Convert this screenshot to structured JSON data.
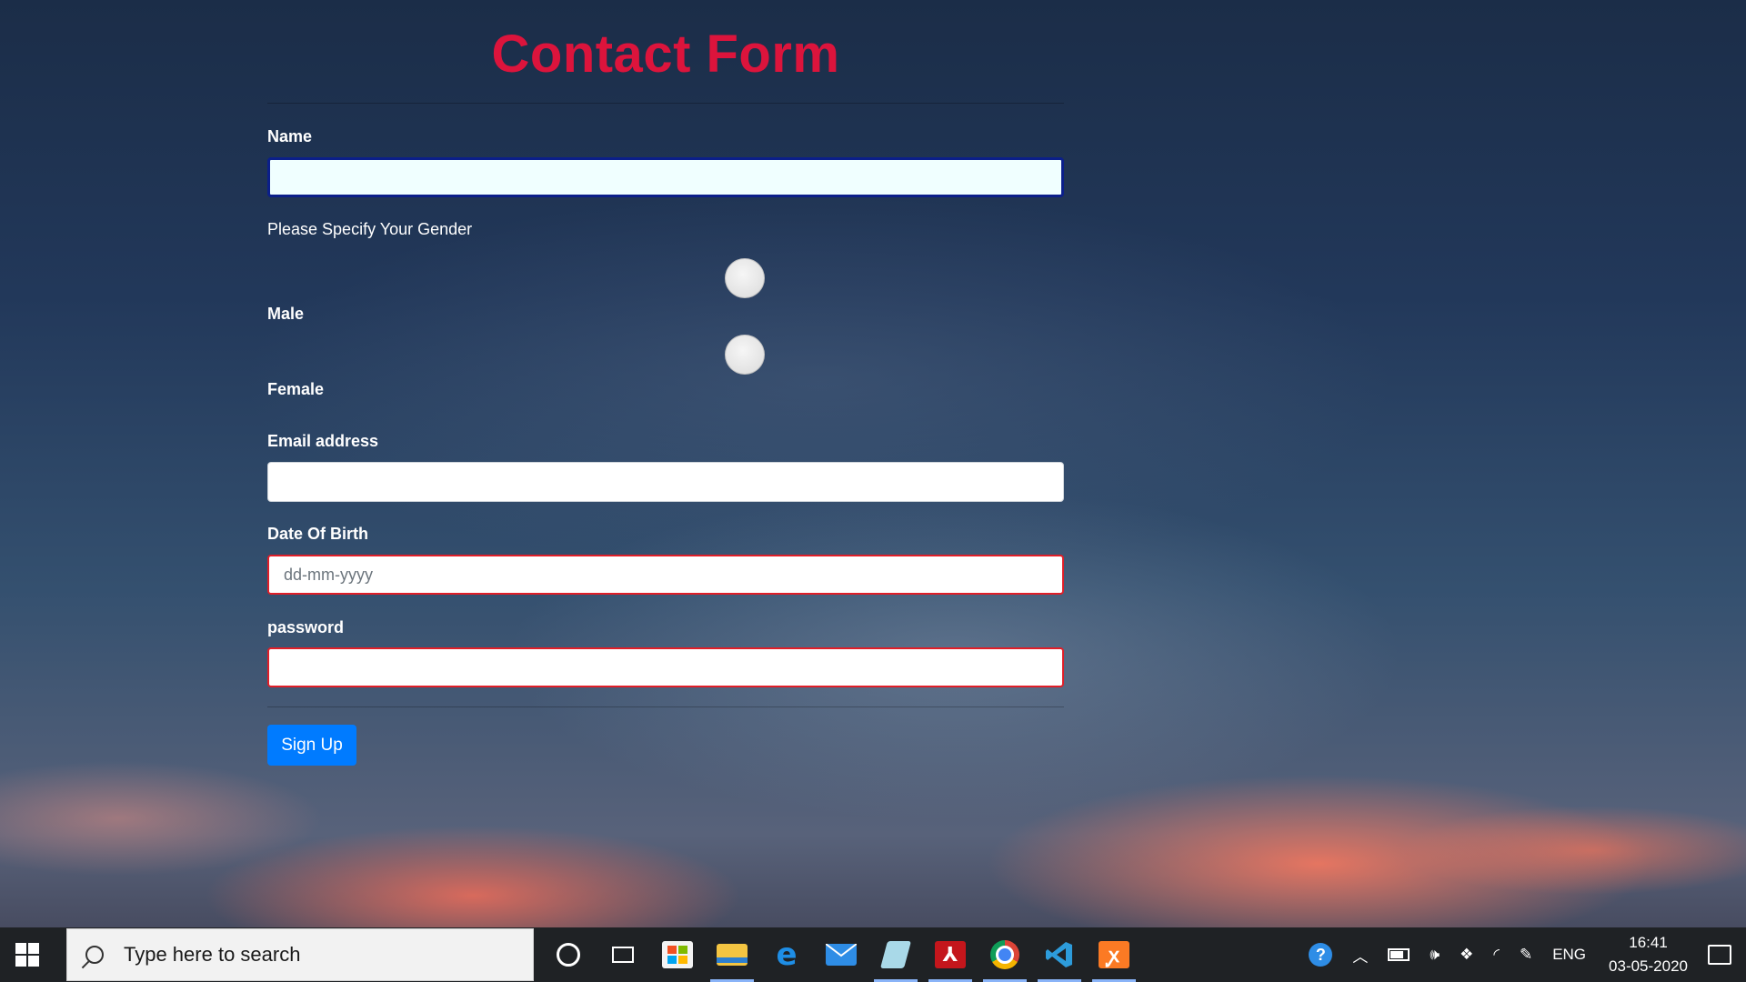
{
  "form": {
    "title": "Contact Form",
    "name_label": "Name",
    "name_value": "",
    "gender_prompt": "Please Specify Your Gender",
    "gender_options": [
      "Male",
      "Female"
    ],
    "email_label": "Email address",
    "email_value": "",
    "dob_label": "Date Of Birth",
    "dob_placeholder": "dd-mm-yyyy",
    "password_label": "password",
    "password_value": "",
    "submit_label": "Sign Up"
  },
  "colors": {
    "title": "#dc143c",
    "button": "#007bff",
    "invalid_border": "#e01e28",
    "focus_border": "#0b1f8a"
  },
  "taskbar": {
    "search_placeholder": "Type here to search",
    "pinned_apps": [
      {
        "name": "microsoft-store-icon"
      },
      {
        "name": "file-explorer-icon"
      },
      {
        "name": "edge-icon"
      },
      {
        "name": "mail-icon"
      },
      {
        "name": "notepad-icon"
      },
      {
        "name": "acrobat-icon"
      },
      {
        "name": "chrome-icon"
      },
      {
        "name": "vscode-icon"
      },
      {
        "name": "xampp-icon"
      }
    ],
    "tray": {
      "language": "ENG",
      "time": "16:41",
      "date": "03-05-2020"
    }
  }
}
